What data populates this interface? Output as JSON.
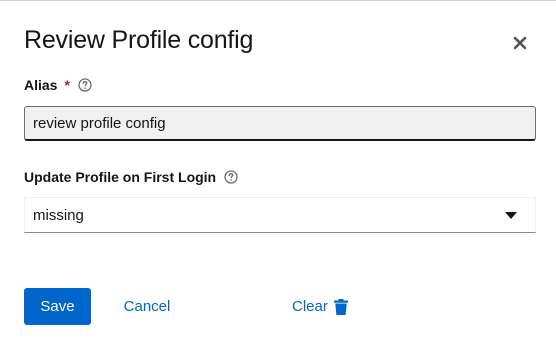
{
  "dialog": {
    "title": "Review Profile config",
    "close_icon": "close-icon"
  },
  "alias": {
    "label": "Alias",
    "required_mark": "*",
    "value": "review profile config",
    "help_icon": "help-icon"
  },
  "update_profile": {
    "label": "Update Profile on First Login",
    "selected": "missing",
    "help_icon": "help-icon"
  },
  "actions": {
    "save_label": "Save",
    "cancel_label": "Cancel",
    "clear_label": "Clear",
    "clear_icon": "trash-icon"
  },
  "colors": {
    "primary": "#0066cc",
    "required": "#c9190b",
    "text": "#151515"
  }
}
